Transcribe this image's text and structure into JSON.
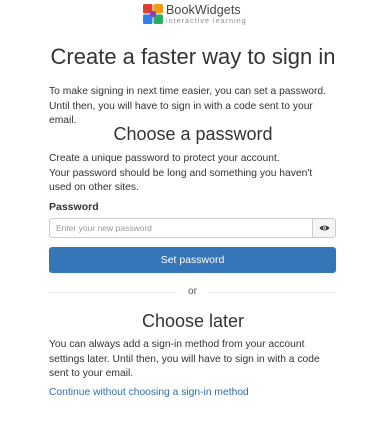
{
  "brand": {
    "name": "BookWidgets",
    "tagline": "interactive learning",
    "logo_colors": [
      "#e0412f",
      "#f39c12",
      "#27ae60",
      "#2f80ed",
      "#8e44ad"
    ]
  },
  "title": "Create a faster way to sign in",
  "intro": "To make signing in next time easier, you can set a password. Until then, you will have to sign in with a code sent to your email.",
  "password_section": {
    "heading": "Choose a password",
    "description_1": "Create a unique password to protect your account.",
    "description_2": "Your password should be long and something you haven't used on other sites.",
    "field_label": "Password",
    "placeholder": "Enter your new password",
    "value": "",
    "show_password_icon": "eye-icon",
    "submit_label": "Set password"
  },
  "separator": "or",
  "later_section": {
    "heading": "Choose later",
    "description": "You can always add a sign-in method from your account settings later. Until then, you will have to sign in with a code sent to your email.",
    "link_label": "Continue without choosing a sign-in method"
  },
  "colors": {
    "primary": "#3476b8",
    "link": "#2f6db0"
  }
}
